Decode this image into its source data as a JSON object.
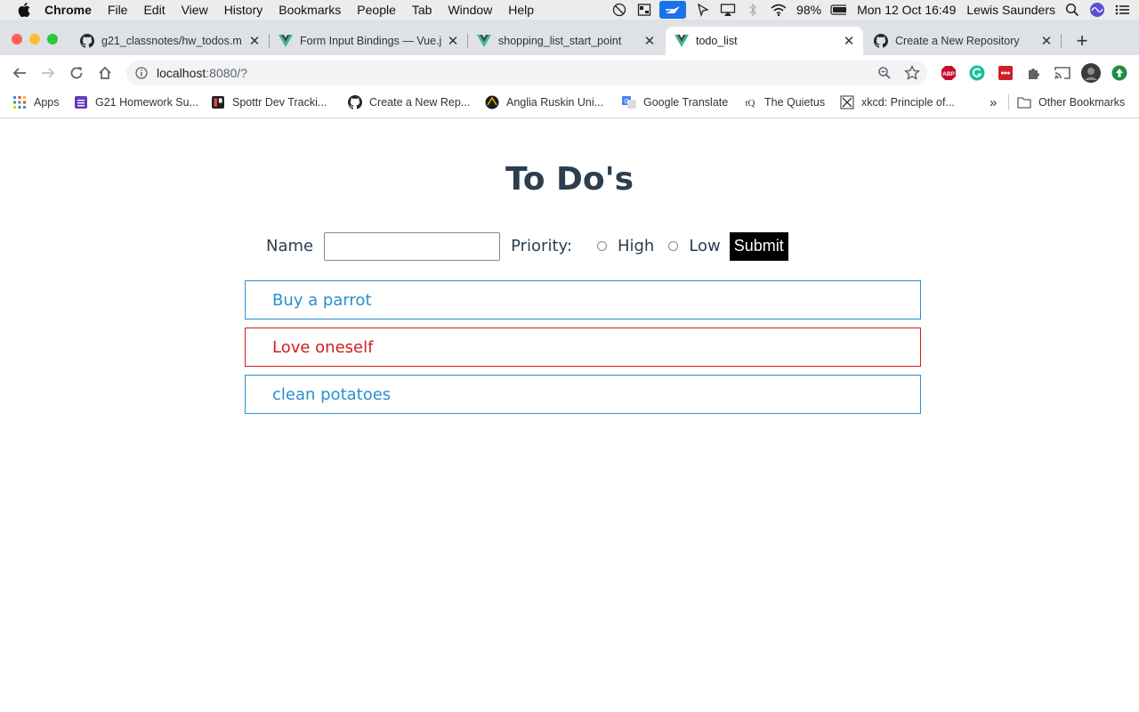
{
  "menubar": {
    "app": "Chrome",
    "items": [
      "File",
      "Edit",
      "View",
      "History",
      "Bookmarks",
      "People",
      "Tab",
      "Window",
      "Help"
    ],
    "battery": "98%",
    "datetime": "Mon 12 Oct  16:49",
    "user": "Lewis Saunders"
  },
  "tabs": [
    {
      "label": "g21_classnotes/hw_todos.m",
      "icon": "github-icon",
      "active": false
    },
    {
      "label": "Form Input Bindings — Vue.j",
      "icon": "vue-icon",
      "active": false
    },
    {
      "label": "shopping_list_start_point",
      "icon": "vue-icon",
      "active": false
    },
    {
      "label": "todo_list",
      "icon": "vue-icon",
      "active": true
    },
    {
      "label": "Create a New Repository",
      "icon": "github-icon",
      "active": false
    }
  ],
  "newtab_label": "+",
  "omnibox": {
    "host": "localhost",
    "rest": ":8080/?"
  },
  "bookmarks": {
    "items": [
      {
        "label": "Apps",
        "icon": "apps-grid-icon"
      },
      {
        "label": "G21 Homework Su...",
        "icon": "sheets-icon"
      },
      {
        "label": "Spottr Dev Tracki...",
        "icon": "trello-icon"
      },
      {
        "label": "Create a New Rep...",
        "icon": "github-icon"
      },
      {
        "label": "Anglia Ruskin Uni...",
        "icon": "aru-icon"
      },
      {
        "label": "Google Translate",
        "icon": "translate-icon"
      },
      {
        "label": "The Quietus",
        "icon": "quietus-icon"
      },
      {
        "label": "xkcd: Principle of...",
        "icon": "xkcd-icon"
      }
    ],
    "overflow": "»",
    "other": "Other Bookmarks"
  },
  "page": {
    "title": "To Do's",
    "name_label": "Name",
    "name_value": "",
    "priority_label": "Priority:",
    "priority_high": "High",
    "priority_low": "Low",
    "submit_label": "Submit",
    "todos": [
      {
        "text": "Buy a parrot",
        "priority": "low"
      },
      {
        "text": "Love oneself",
        "priority": "high"
      },
      {
        "text": "clean potatoes",
        "priority": "low"
      }
    ]
  },
  "colors": {
    "heading": "#2c3e50",
    "low": "#2a8fcf",
    "high": "#d01e1e",
    "vue_green": "#41b883"
  }
}
